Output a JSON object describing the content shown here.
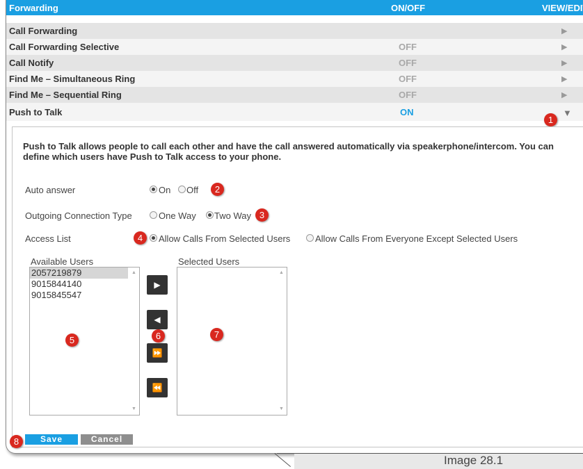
{
  "header": {
    "title": "Forwarding",
    "onoff": "ON/OFF",
    "viewedit": "VIEW/EDIT"
  },
  "rows": [
    {
      "label": "Call Forwarding",
      "status": ""
    },
    {
      "label": "Call Forwarding Selective",
      "status": "OFF"
    },
    {
      "label": "Call Notify",
      "status": "OFF"
    },
    {
      "label": "Find Me – Simultaneous Ring",
      "status": "OFF"
    },
    {
      "label": "Find Me – Sequential Ring",
      "status": "OFF"
    },
    {
      "label": "Push to Talk",
      "status": "ON"
    }
  ],
  "icons": {
    "row_arrow": "▶",
    "expanded_arrow": "▼"
  },
  "description": "Push to Talk allows people to call each other and have the call answered automatically via speakerphone/intercom. You can define which users have Push to Talk access to your phone.",
  "auto_answer": {
    "label": "Auto answer",
    "on": "On",
    "off": "Off",
    "selected": "On"
  },
  "outgoing": {
    "label": "Outgoing Connection Type",
    "one_way": "One Way",
    "two_way": "Two Way",
    "selected": "Two Way"
  },
  "access_list": {
    "label": "Access List",
    "opt1": "Allow Calls From Selected Users",
    "opt2": "Allow Calls From Everyone Except Selected Users",
    "selected": "Allow Calls From Selected Users"
  },
  "available_users": {
    "label": "Available Users",
    "items": [
      "2057219879",
      "9015844140",
      "9015845547"
    ],
    "selected": "2057219879"
  },
  "selected_users": {
    "label": "Selected Users",
    "items": []
  },
  "buttons": {
    "save": "Save",
    "cancel": "Cancel",
    "add": "▶",
    "remove": "◀",
    "add_all": "⏩",
    "remove_all": "⏪"
  },
  "badges": [
    "1",
    "2",
    "3",
    "4",
    "5",
    "6",
    "7",
    "8"
  ],
  "caption": "Image 28.1",
  "colors": {
    "accent": "#1a9fe2",
    "badge": "#d9281f",
    "status_on": "#1a9fe2",
    "status_off": "#a8a8a8"
  }
}
